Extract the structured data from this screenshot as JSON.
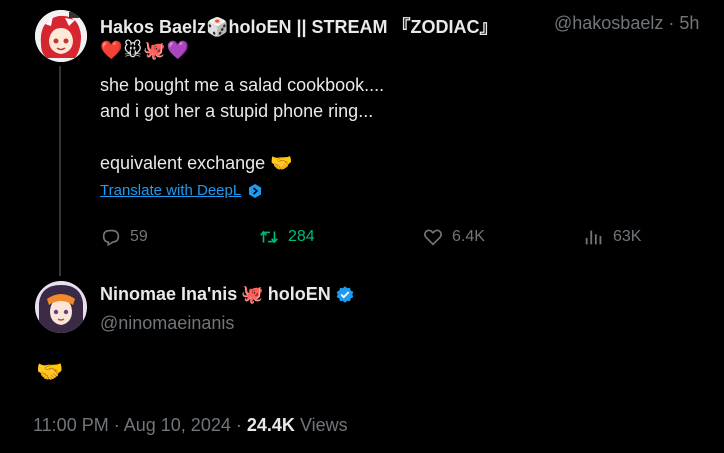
{
  "tweet": {
    "author_name": "Hakos Baelz",
    "author_name_suffix": "holoEN || STREAM 『ZODIAC』",
    "author_handle": "@hakosbaelz",
    "time_sep": "·",
    "time_ago": "5h",
    "name_emoji": "🎲",
    "emoji_row": "❤️🐭🐙💜",
    "body_lines": [
      "she bought me a salad cookbook....",
      "and i got her a stupid phone ring..."
    ],
    "body_line3": "equivalent exchange 🤝",
    "translate_label": "Translate with DeepL",
    "actions": {
      "replies": "59",
      "retweets": "284",
      "likes": "6.4K",
      "views": "63K"
    }
  },
  "reply": {
    "author_name": "Ninomae Ina'nis",
    "name_emoji": "🐙",
    "name_suffix": "holoEN",
    "author_handle": "@ninomaeinanis",
    "body": "🤝"
  },
  "footer": {
    "time": "11:00 PM",
    "sep1": "·",
    "date": "Aug 10, 2024",
    "sep2": "·",
    "views_count": "24.4K",
    "views_label": "Views"
  },
  "colors": {
    "background": "#000000",
    "text": "#e7e9ea",
    "muted": "#71767b",
    "link": "#1d9bf0",
    "retweet": "#00ba7c",
    "verified": "#1d9bf0"
  }
}
